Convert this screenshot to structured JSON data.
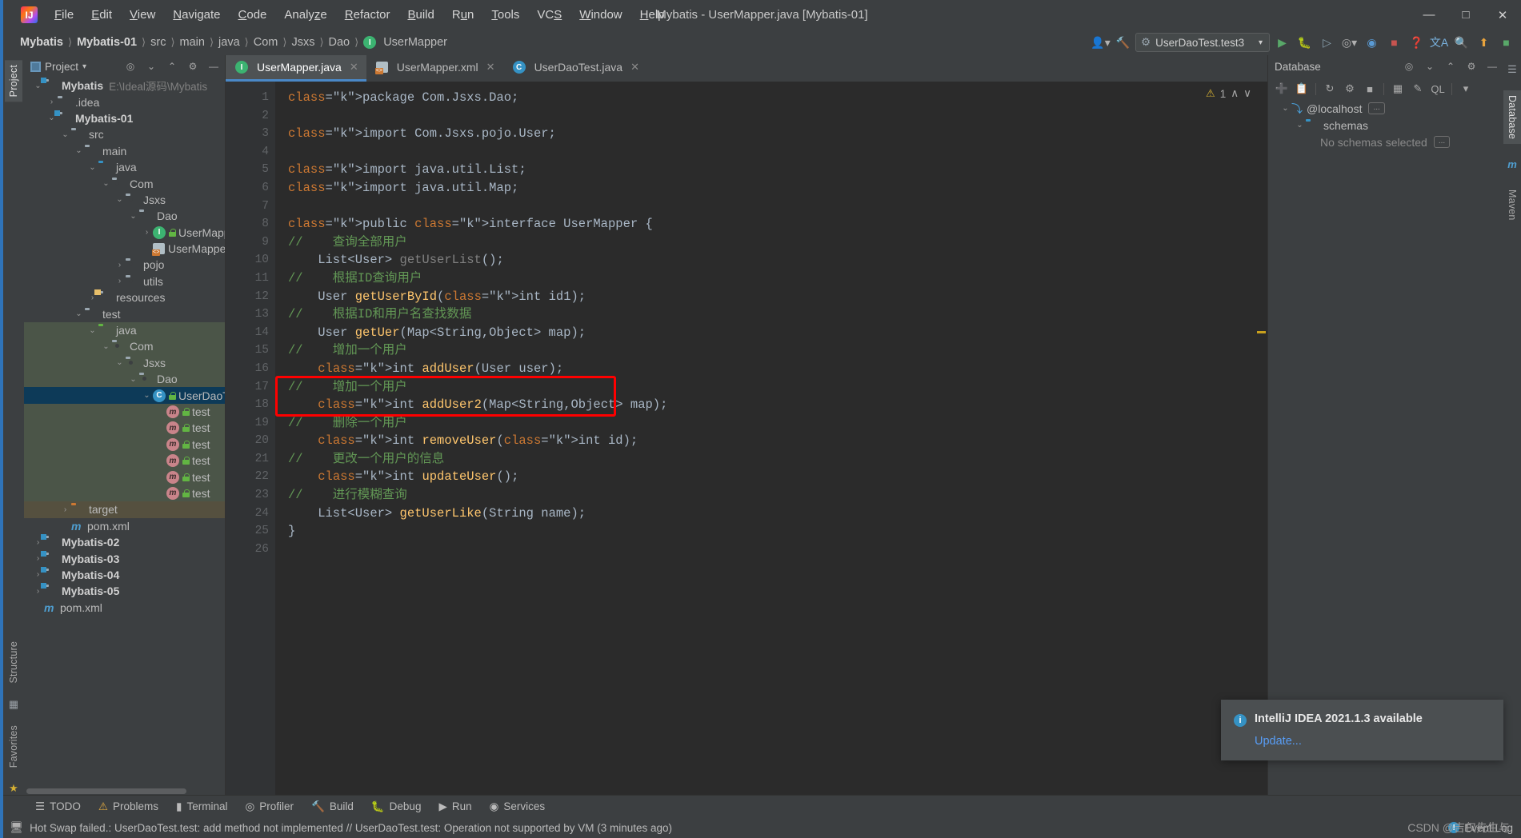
{
  "window": {
    "title": "Mybatis - UserMapper.java [Mybatis-01]",
    "minimize": "—",
    "maximize": "☐",
    "close": "✕"
  },
  "menubar": [
    {
      "label": "File"
    },
    {
      "label": "Edit"
    },
    {
      "label": "View"
    },
    {
      "label": "Navigate"
    },
    {
      "label": "Code"
    },
    {
      "label": "Analyze"
    },
    {
      "label": "Refactor"
    },
    {
      "label": "Build"
    },
    {
      "label": "Run"
    },
    {
      "label": "Tools"
    },
    {
      "label": "VCS"
    },
    {
      "label": "Window"
    },
    {
      "label": "Help"
    }
  ],
  "breadcrumb": [
    "Mybatis",
    "Mybatis-01",
    "src",
    "main",
    "java",
    "Com",
    "Jsxs",
    "Dao",
    "UserMapper"
  ],
  "toolbar": {
    "run_config": "UserDaoTest.test3",
    "run_icon": "run-icon",
    "debug_icon": "debug-icon",
    "coverage_icon": "coverage-icon",
    "profile_icon": "profile-icon",
    "stop_icon": "stop-icon",
    "search_icon": "search-icon",
    "settings_icon": "settings-icon",
    "update_icon": "update-icon",
    "user_icon": "user-icon",
    "hammer_icon": "build-icon",
    "translate_icon": "translate-icon",
    "help_icon": "help-icon"
  },
  "left_tool_tabs": [
    {
      "label": "Project",
      "active": true
    },
    {
      "label": "Structure",
      "active": false
    },
    {
      "label": "Favorites",
      "active": false
    }
  ],
  "right_tool_tabs": [
    {
      "label": "Database",
      "active": true
    },
    {
      "label": "Maven",
      "active": false
    }
  ],
  "project_panel": {
    "title": "Project",
    "icons": [
      "locate-icon",
      "expand-all-icon",
      "collapse-all-icon",
      "gear-icon",
      "hide-icon"
    ],
    "tree": [
      {
        "indent": 0,
        "arrow": "v",
        "icon": "module-folder",
        "label": "Mybatis",
        "bold": true,
        "path": "E:\\Ideal源码\\Mybatis"
      },
      {
        "indent": 1,
        "arrow": ">",
        "icon": "folder",
        "label": ".idea"
      },
      {
        "indent": 1,
        "arrow": "v",
        "icon": "module-folder",
        "label": "Mybatis-01",
        "bold": true
      },
      {
        "indent": 2,
        "arrow": "v",
        "icon": "folder",
        "label": "src"
      },
      {
        "indent": 3,
        "arrow": "v",
        "icon": "folder",
        "label": "main"
      },
      {
        "indent": 4,
        "arrow": "v",
        "icon": "folder-blue",
        "label": "java"
      },
      {
        "indent": 5,
        "arrow": "v",
        "icon": "package",
        "label": "Com"
      },
      {
        "indent": 6,
        "arrow": "v",
        "icon": "package",
        "label": "Jsxs"
      },
      {
        "indent": 7,
        "arrow": "v",
        "icon": "package",
        "label": "Dao"
      },
      {
        "indent": 8,
        "arrow": ">",
        "icon": "interface",
        "label": "UserMapper",
        "lock": true
      },
      {
        "indent": 8,
        "arrow": "",
        "icon": "xml",
        "label": "UserMapper.xml"
      },
      {
        "indent": 6,
        "arrow": ">",
        "icon": "package",
        "label": "pojo"
      },
      {
        "indent": 6,
        "arrow": ">",
        "icon": "package",
        "label": "utils"
      },
      {
        "indent": 4,
        "arrow": ">",
        "icon": "folder-res",
        "label": "resources"
      },
      {
        "indent": 3,
        "arrow": "v",
        "icon": "folder",
        "label": "test"
      },
      {
        "indent": 4,
        "arrow": "v",
        "icon": "folder-green",
        "label": "java",
        "test": true
      },
      {
        "indent": 5,
        "arrow": "v",
        "icon": "package",
        "label": "Com",
        "test": true
      },
      {
        "indent": 6,
        "arrow": "v",
        "icon": "package",
        "label": "Jsxs",
        "test": true
      },
      {
        "indent": 7,
        "arrow": "v",
        "icon": "package",
        "label": "Dao",
        "test": true
      },
      {
        "indent": 8,
        "arrow": "v",
        "icon": "class",
        "label": "UserDaoTest",
        "selected": true,
        "lock": true
      },
      {
        "indent": 9,
        "arrow": "",
        "icon": "method",
        "label": "test",
        "test": true,
        "lock": true
      },
      {
        "indent": 9,
        "arrow": "",
        "icon": "method",
        "label": "test",
        "test": true,
        "lock": true
      },
      {
        "indent": 9,
        "arrow": "",
        "icon": "method",
        "label": "test",
        "test": true,
        "lock": true
      },
      {
        "indent": 9,
        "arrow": "",
        "icon": "method",
        "label": "test",
        "test": true,
        "lock": true
      },
      {
        "indent": 9,
        "arrow": "",
        "icon": "method",
        "label": "test",
        "test": true,
        "lock": true
      },
      {
        "indent": 9,
        "arrow": "",
        "icon": "method",
        "label": "test",
        "test": true,
        "lock": true
      },
      {
        "indent": 2,
        "arrow": ">",
        "icon": "folder-orange",
        "label": "target",
        "target": true
      },
      {
        "indent": 2,
        "arrow": "",
        "icon": "maven",
        "label": "pom.xml"
      },
      {
        "indent": 0,
        "arrow": ">",
        "icon": "module-folder",
        "label": "Mybatis-02",
        "bold": true
      },
      {
        "indent": 0,
        "arrow": ">",
        "icon": "module-folder",
        "label": "Mybatis-03",
        "bold": true
      },
      {
        "indent": 0,
        "arrow": ">",
        "icon": "module-folder",
        "label": "Mybatis-04",
        "bold": true
      },
      {
        "indent": 0,
        "arrow": ">",
        "icon": "module-folder",
        "label": "Mybatis-05",
        "bold": true
      },
      {
        "indent": 0,
        "arrow": "",
        "icon": "maven",
        "label": "pom.xml"
      }
    ]
  },
  "editor": {
    "tabs": [
      {
        "label": "UserMapper.java",
        "icon": "interface-icon",
        "active": true
      },
      {
        "label": "UserMapper.xml",
        "icon": "xml-icon",
        "active": false
      },
      {
        "label": "UserDaoTest.java",
        "icon": "class-icon",
        "active": false
      }
    ],
    "inspection": {
      "warning_count": "1",
      "up": "∧",
      "down": "∨"
    },
    "first_line": 1,
    "last_line": 26,
    "lines": [
      {
        "n": 1,
        "text": "package Com.Jsxs.Dao;"
      },
      {
        "n": 2,
        "text": ""
      },
      {
        "n": 3,
        "text": "import Com.Jsxs.pojo.User;",
        "fold": "v"
      },
      {
        "n": 4,
        "text": ""
      },
      {
        "n": 5,
        "text": "import java.util.List;"
      },
      {
        "n": 6,
        "text": "import java.util.Map;",
        "fold": "^"
      },
      {
        "n": 7,
        "text": ""
      },
      {
        "n": 8,
        "text": "public interface UserMapper {"
      },
      {
        "n": 9,
        "text": "//    查询全部用户"
      },
      {
        "n": 10,
        "text": "    List<User> getUserList();"
      },
      {
        "n": 11,
        "text": "//    根据ID查询用户"
      },
      {
        "n": 12,
        "text": "    User getUserById(int id1);"
      },
      {
        "n": 13,
        "text": "//    根据ID和用户名查找数据"
      },
      {
        "n": 14,
        "text": "    User getUer(Map<String,Object> map);"
      },
      {
        "n": 15,
        "text": "//    增加一个用户"
      },
      {
        "n": 16,
        "text": "    int addUser(User user);"
      },
      {
        "n": 17,
        "text": "//    增加一个用户"
      },
      {
        "n": 18,
        "text": "    int addUser2(Map<String,Object> map);"
      },
      {
        "n": 19,
        "text": "//    删除一个用户"
      },
      {
        "n": 20,
        "text": "    int removeUser(int id);"
      },
      {
        "n": 21,
        "text": "//    更改一个用户的信息"
      },
      {
        "n": 22,
        "text": "    int updateUser();"
      },
      {
        "n": 23,
        "text": "//    进行模糊查询"
      },
      {
        "n": 24,
        "text": "    List<User> getUserLike(String name);"
      },
      {
        "n": 25,
        "text": "}"
      },
      {
        "n": 26,
        "text": ""
      }
    ],
    "annotation": {
      "color": "#ff0000",
      "covers_lines": "17-18"
    }
  },
  "database_panel": {
    "title": "Database",
    "header_icons": [
      "locate-icon",
      "expand-all-icon",
      "collapse-all-icon",
      "gear-icon",
      "hide-icon"
    ],
    "toolbar_icons": [
      "add-icon",
      "copy-icon",
      "refresh-icon",
      "sync-icon",
      "stop-icon",
      "table-icon",
      "edit-icon",
      "query-console-icon",
      "filter-icon"
    ],
    "tree": [
      {
        "indent": 0,
        "arrow": "v",
        "icon": "mysql-icon",
        "label": "@localhost",
        "ellipsis": "..."
      },
      {
        "indent": 1,
        "arrow": "v",
        "icon": "folder-blue",
        "label": "schemas"
      },
      {
        "indent": 2,
        "arrow": "",
        "icon": "",
        "label": "No schemas selected",
        "muted": true,
        "ellipsis": "..."
      }
    ]
  },
  "tool_windows": [
    {
      "label": "TODO",
      "icon": "todo-icon"
    },
    {
      "label": "Problems",
      "icon": "problems-icon"
    },
    {
      "label": "Terminal",
      "icon": "terminal-icon"
    },
    {
      "label": "Profiler",
      "icon": "profiler-icon"
    },
    {
      "label": "Build",
      "icon": "build-icon"
    },
    {
      "label": "Debug",
      "icon": "debug-icon"
    },
    {
      "label": "Run",
      "icon": "run-icon"
    },
    {
      "label": "Services",
      "icon": "services-icon"
    }
  ],
  "statusbar": {
    "message": "Hot Swap failed.: UserDaoTest.test: add method not implemented // UserDaoTest.test: Operation not supported by VM (3 minutes ago)",
    "icon": "ide-message-icon",
    "event_log": "Event Log"
  },
  "notification": {
    "title": "IntelliJ IDEA 2021.1.3 available",
    "action": "Update...",
    "icon": "info-icon"
  },
  "watermark": "CSDN @吉仅先生与"
}
